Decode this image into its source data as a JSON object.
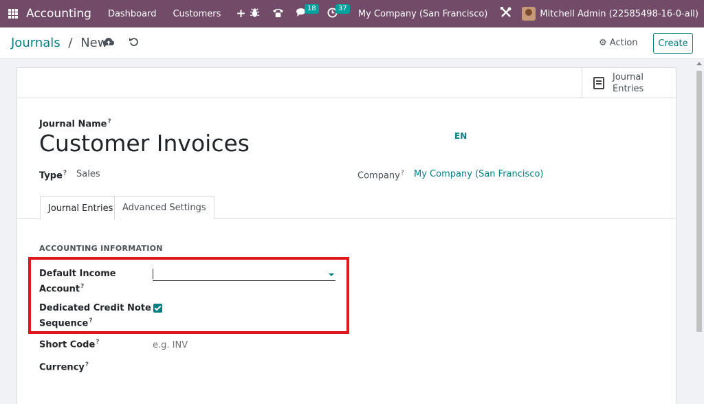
{
  "navbar": {
    "app_name": "Accounting",
    "menu": [
      "Dashboard",
      "Customers"
    ],
    "plus_icon": "+",
    "messages_count": "18",
    "activities_count": "37",
    "company": "My Company (San Francisco)",
    "user": "Mitchell Admin (22585498-16-0-all)",
    "brand_color": "#714b67"
  },
  "control_panel": {
    "breadcrumb_parent": "Journals",
    "breadcrumb_separator": "/",
    "breadcrumb_current": "New",
    "action_label": "Action",
    "create_label": "Create"
  },
  "sheet": {
    "stat_button_line1": "Journal",
    "stat_button_line2": "Entries",
    "journal_name_label": "Journal Name",
    "journal_name_value": "Customer Invoices",
    "lang": "EN",
    "type_label": "Type",
    "type_value": "Sales",
    "company_label": "Company",
    "company_value": "My Company (San Francisco)",
    "help_mark": "?",
    "tabs": [
      "Journal Entries",
      "Advanced Settings"
    ],
    "section_title": "ACCOUNTING INFORMATION",
    "default_income_label_1": "Default Income",
    "default_income_label_2": "Account",
    "credit_note_label_1": "Dedicated Credit Note",
    "credit_note_label_2": "Sequence",
    "credit_note_checked": true,
    "short_code_label": "Short Code",
    "short_code_placeholder": "e.g. INV",
    "currency_label": "Currency",
    "accent_color": "#017e84",
    "highlight_color": "#e0161e"
  }
}
